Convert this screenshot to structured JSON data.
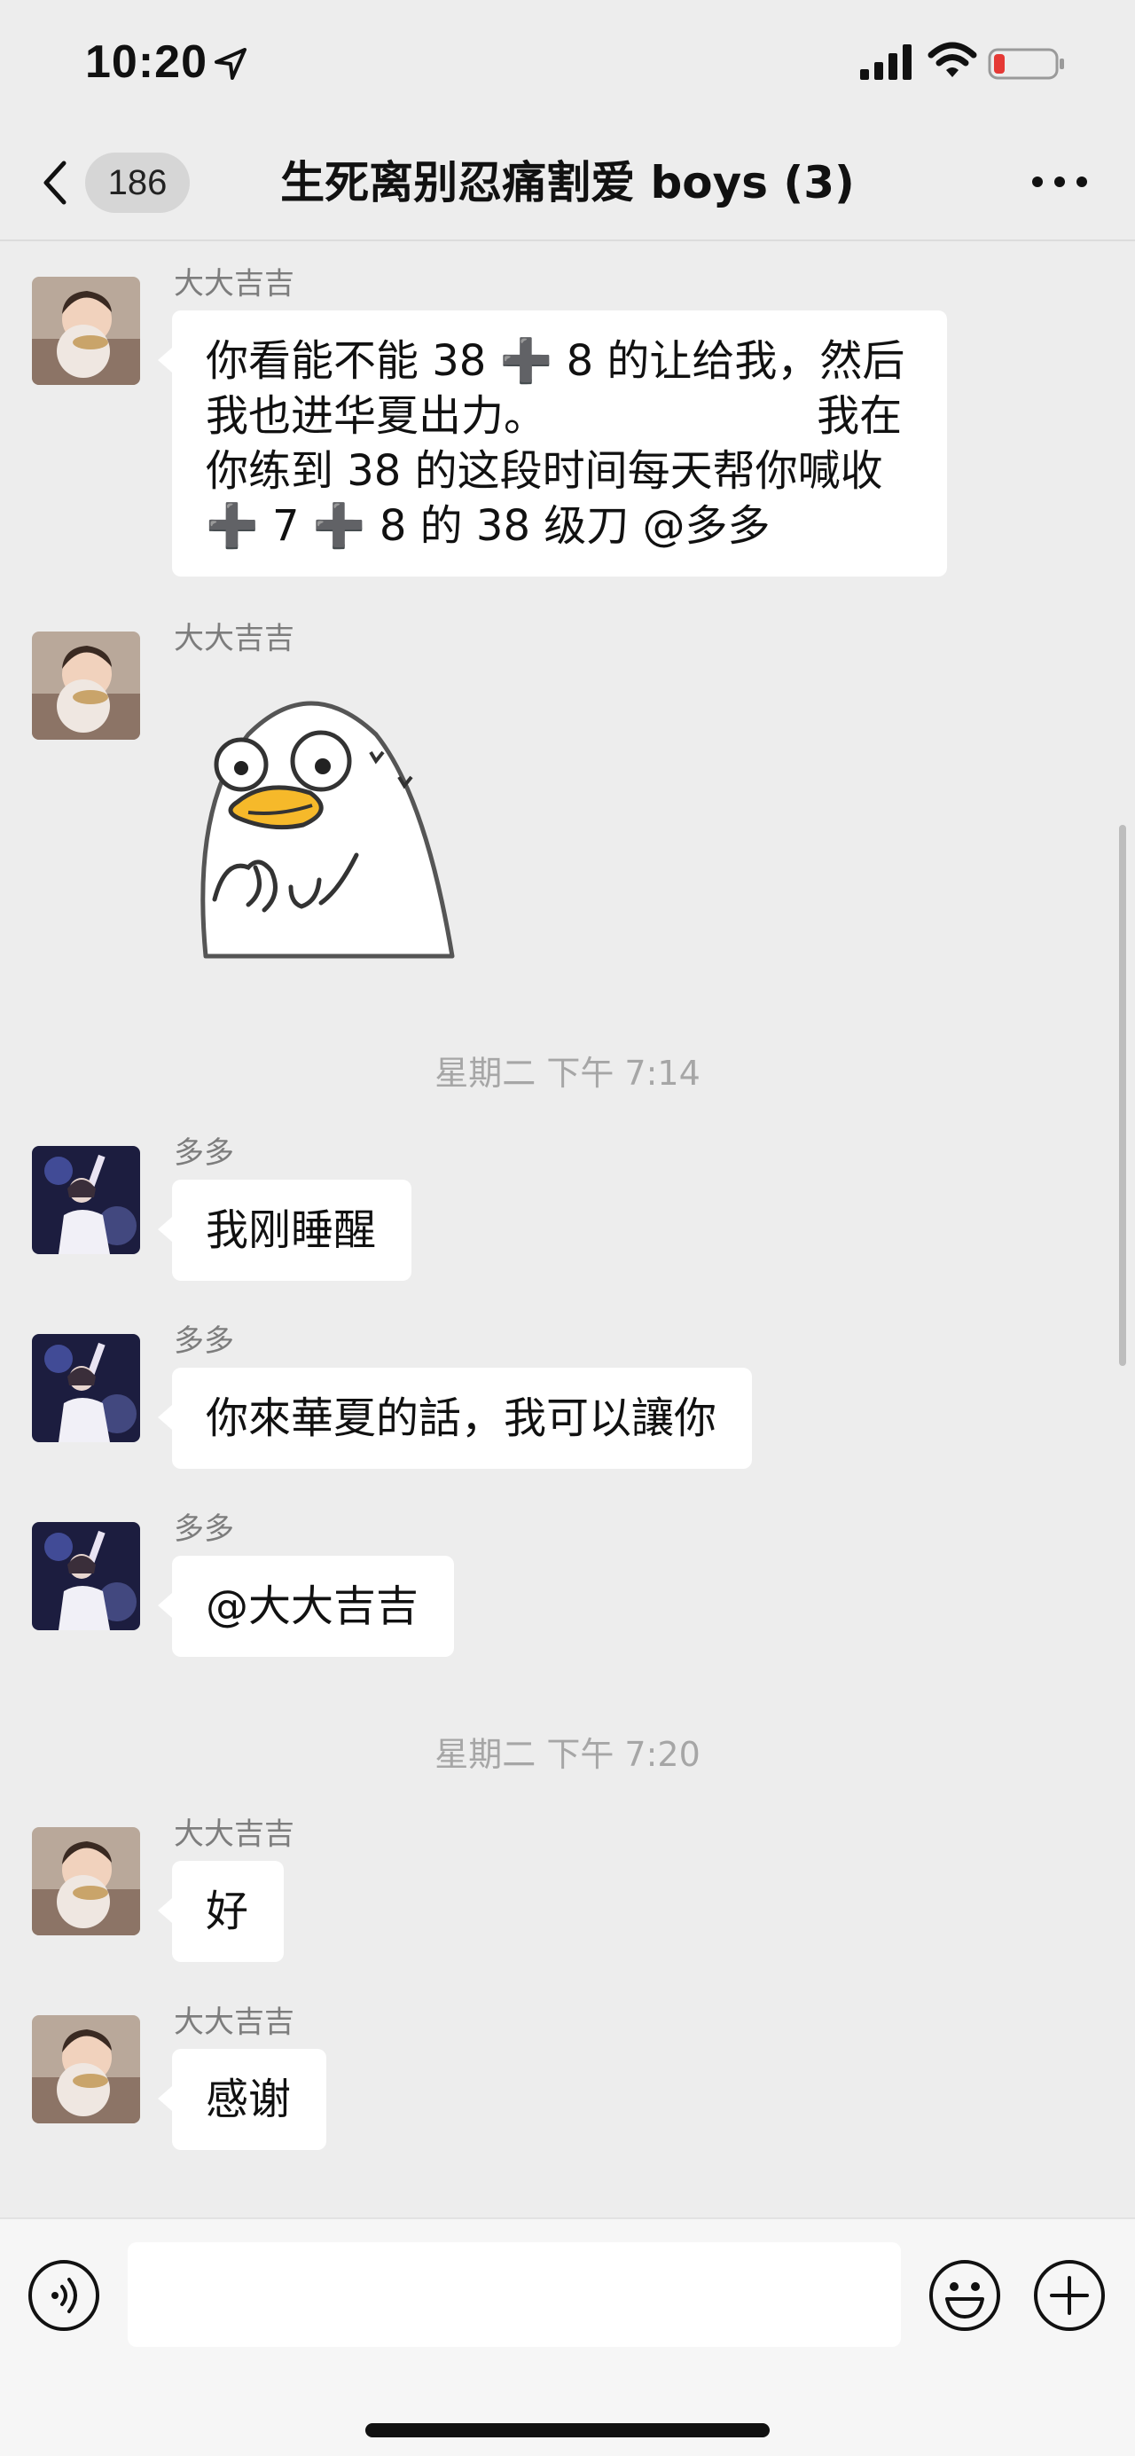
{
  "status_bar": {
    "time": "10:20"
  },
  "nav": {
    "back_badge": "186",
    "title": "生死离别忍痛割爱 boys (3)"
  },
  "messages": [
    {
      "sender": "大大吉吉",
      "text": "你看能不能 38 ➕ 8 的让给我，然后\n我也进华夏出力。                    我在\n你练到 38 的这段时间每天帮你喊收\n➕ 7 ➕ 8 的 38 级刀 @多多"
    },
    {
      "sender": "大大吉吉",
      "sticker": "duck-sticker"
    },
    {
      "sender": "多多",
      "text": "我刚睡醒"
    },
    {
      "sender": "多多",
      "text": "你來華夏的話，我可以讓你"
    },
    {
      "sender": "多多",
      "text": "@大大吉吉"
    },
    {
      "sender": "大大吉吉",
      "text": "好"
    },
    {
      "sender": "大大吉吉",
      "text": "感谢"
    }
  ],
  "timestamps": [
    "星期二 下午 7:14",
    "星期二 下午 7:20"
  ],
  "input": {
    "value": "",
    "placeholder": ""
  },
  "icons": [
    "location-arrow-icon",
    "signal-icon",
    "wifi-icon",
    "battery-icon",
    "back-chevron-icon",
    "more-dots-icon",
    "voice-icon",
    "emoji-icon",
    "plus-icon"
  ],
  "colors": {
    "background": "#ededed",
    "bubble": "#ffffff",
    "battery_low": "#e53935",
    "sender_text": "#7d7d7d"
  }
}
